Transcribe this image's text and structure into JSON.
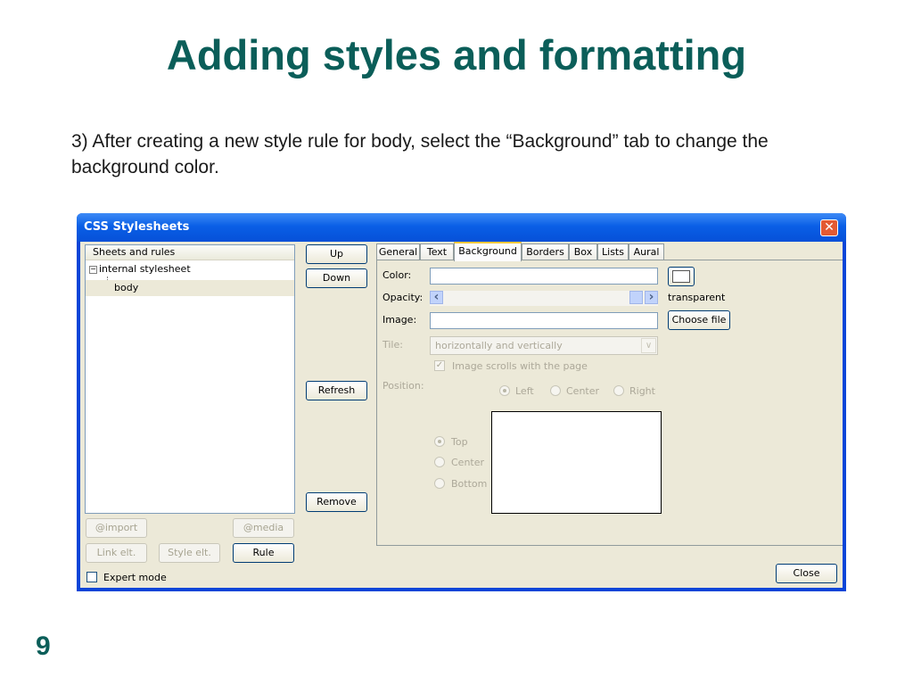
{
  "slide": {
    "title": "Adding styles and formatting",
    "text": "3) After creating a new style rule for body, select the “Background” tab to change the background color.",
    "page_number": "9"
  },
  "window": {
    "title": "CSS Stylesheets",
    "close_glyph": "✕"
  },
  "tree": {
    "header": "Sheets and rules",
    "items": [
      {
        "label": "internal stylesheet",
        "expander": "−"
      },
      {
        "label": "body"
      }
    ]
  },
  "order_buttons": {
    "up": "Up",
    "down": "Down",
    "refresh": "Refresh",
    "remove": "Remove"
  },
  "bottom_buttons": {
    "import": "@import",
    "media": "@media",
    "link_elt": "Link elt.",
    "style_elt": "Style elt.",
    "rule": "Rule",
    "expert_mode": "Expert mode",
    "close": "Close"
  },
  "tabs": [
    {
      "label": "General"
    },
    {
      "label": "Text"
    },
    {
      "label": "Background"
    },
    {
      "label": "Borders"
    },
    {
      "label": "Box"
    },
    {
      "label": "Lists"
    },
    {
      "label": "Aural"
    }
  ],
  "background_tab": {
    "color_label": "Color:",
    "color_value": "",
    "opacity_label": "Opacity:",
    "opacity_text": "transparent",
    "image_label": "Image:",
    "image_value": "",
    "choose_file": "Choose file",
    "tile_label": "Tile:",
    "tile_value": "horizontally and vertically",
    "scrolls_label": "Image scrolls with the page",
    "position_label": "Position:",
    "h_left": "Left",
    "h_center": "Center",
    "h_right": "Right",
    "v_top": "Top",
    "v_center": "Center",
    "v_bottom": "Bottom"
  },
  "icons": {
    "arrow_left": "‹",
    "arrow_right": "›",
    "dropdown": "∨",
    "check": "✓"
  }
}
